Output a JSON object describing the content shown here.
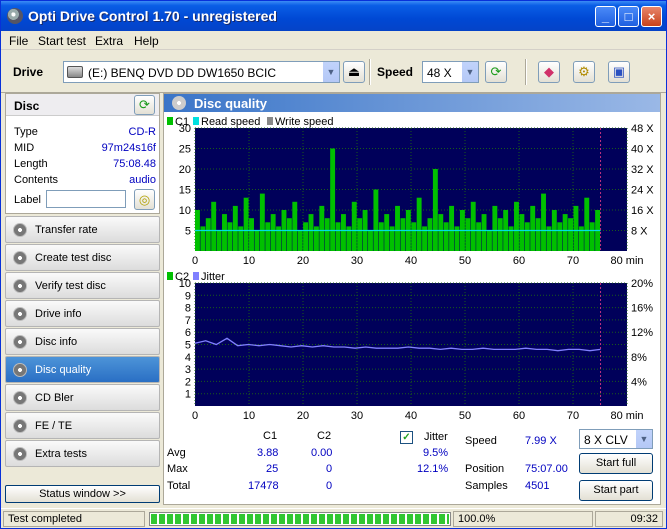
{
  "window": {
    "title": "Opti Drive Control 1.70 - unregistered",
    "minimize": "_",
    "maximize": "□",
    "close": "×"
  },
  "menu": [
    "File",
    "Start test",
    "Extra",
    "Help"
  ],
  "toolbar": {
    "drive_label": "Drive",
    "drive_value": "(E:)  BENQ DVD DD DW1650 BCIC",
    "speed_label": "Speed",
    "speed_value": "48 X"
  },
  "disc": {
    "heading": "Disc",
    "type_label": "Type",
    "type": "CD-R",
    "mid_label": "MID",
    "mid": "97m24s16f",
    "length_label": "Length",
    "length": "75:08.48",
    "contents_label": "Contents",
    "contents": "audio",
    "label_label": "Label",
    "label_value": ""
  },
  "nav": [
    {
      "label": "Transfer rate",
      "active": false
    },
    {
      "label": "Create test disc",
      "active": false
    },
    {
      "label": "Verify test disc",
      "active": false
    },
    {
      "label": "Drive info",
      "active": false
    },
    {
      "label": "Disc info",
      "active": false
    },
    {
      "label": "Disc quality",
      "active": true
    },
    {
      "label": "CD Bler",
      "active": false
    },
    {
      "label": "FE / TE",
      "active": false
    },
    {
      "label": "Extra tests",
      "active": false
    }
  ],
  "status_window_button": "Status window >>",
  "main": {
    "heading": "Disc quality"
  },
  "chart_data": [
    {
      "type": "bar",
      "legend": [
        "C1",
        "Read speed",
        "Write speed"
      ],
      "x_ticks": [
        "0",
        "10",
        "20",
        "30",
        "40",
        "50",
        "60",
        "70",
        "80 min"
      ],
      "y_ticks": [
        "5",
        "10",
        "15",
        "20",
        "25",
        "30"
      ],
      "y2_ticks": [
        "8 X",
        "16 X",
        "24 X",
        "32 X",
        "40 X",
        "48 X"
      ],
      "xlim": [
        0,
        80
      ],
      "ylim": [
        0,
        30
      ],
      "end_minutes": 75.1,
      "series": [
        {
          "name": "C1",
          "color": "#00c000",
          "values": [
            10,
            6,
            8,
            12,
            5,
            9,
            7,
            11,
            6,
            13,
            8,
            5,
            14,
            7,
            9,
            6,
            10,
            8,
            12,
            5,
            7,
            9,
            6,
            11,
            8,
            25,
            7,
            9,
            6,
            12,
            8,
            10,
            5,
            15,
            7,
            9,
            6,
            11,
            8,
            10,
            7,
            13,
            6,
            8,
            20,
            9,
            7,
            11,
            6,
            10,
            8,
            12,
            7,
            9,
            5,
            11,
            8,
            10,
            6,
            12,
            9,
            7,
            11,
            8,
            14,
            6,
            10,
            7,
            9,
            8,
            11,
            6,
            13,
            7,
            10
          ]
        },
        {
          "name": "Read speed",
          "color": "#00e0e0",
          "values": [
            7.99
          ]
        }
      ]
    },
    {
      "type": "line",
      "legend": [
        "C2",
        "Jitter"
      ],
      "x_ticks": [
        "0",
        "10",
        "20",
        "30",
        "40",
        "50",
        "60",
        "70",
        "80 min"
      ],
      "y_ticks": [
        "1",
        "2",
        "3",
        "4",
        "5",
        "6",
        "7",
        "8",
        "9",
        "10"
      ],
      "y2_ticks": [
        "4%",
        "8%",
        "12%",
        "16%",
        "20%"
      ],
      "xlim": [
        0,
        80
      ],
      "ylim": [
        0,
        10
      ],
      "series": [
        {
          "name": "Jitter",
          "color": "#8080ff",
          "values": [
            5.1,
            5.3,
            5.0,
            5.5,
            4.9,
            5.0,
            4.9,
            5.0,
            4.9,
            4.8,
            4.9,
            4.8,
            4.9,
            4.8,
            4.8,
            4.7,
            4.8,
            4.7,
            4.7,
            4.7,
            4.8,
            4.7,
            4.7,
            4.6,
            4.7,
            4.6,
            4.6,
            4.7,
            4.6,
            4.6,
            4.6,
            4.7,
            4.6,
            4.6,
            4.5,
            4.6,
            4.6,
            4.5,
            4.6
          ]
        },
        {
          "name": "C2",
          "color": "#00c000",
          "values": [
            0
          ]
        }
      ]
    }
  ],
  "stats": {
    "col_c1": "C1",
    "col_c2": "C2",
    "avg_label": "Avg",
    "avg_c1": "3.88",
    "avg_c2": "0.00",
    "max_label": "Max",
    "max_c1": "25",
    "max_c2": "0",
    "total_label": "Total",
    "total_c1": "17478",
    "total_c2": "0",
    "jitter_label": "Jitter",
    "jitter_checked": true,
    "jitter_avg": "9.5%",
    "jitter_max": "12.1%",
    "speed_label": "Speed",
    "speed_value": "7.99 X",
    "speed_select": "8 X CLV",
    "position_label": "Position",
    "position_value": "75:07.00",
    "samples_label": "Samples",
    "samples_value": "4501",
    "start_full": "Start full",
    "start_part": "Start part"
  },
  "statusbar": {
    "text": "Test completed",
    "progress": "100.0%",
    "progress_fraction": 1.0,
    "time": "09:32"
  }
}
